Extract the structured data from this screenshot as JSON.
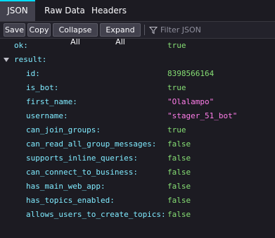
{
  "tabs": [
    {
      "label": "JSON",
      "active": true
    },
    {
      "label": "Raw Data",
      "active": false
    },
    {
      "label": "Headers",
      "active": false
    }
  ],
  "toolbar": {
    "save_label": "Save",
    "copy_label": "Copy",
    "collapse_label": "Collapse All",
    "expand_label": "Expand All",
    "filter_placeholder": "Filter JSON",
    "filter_value": ""
  },
  "json": {
    "ok": {
      "key": "ok:",
      "value": "true"
    },
    "result": {
      "key": "result:",
      "expanded": true,
      "fields": [
        {
          "key": "id:",
          "value": "8398566164",
          "type": "num"
        },
        {
          "key": "is_bot:",
          "value": "true",
          "type": "bool"
        },
        {
          "key": "first_name:",
          "value": "\"Olalampo\"",
          "type": "str"
        },
        {
          "key": "username:",
          "value": "\"stager_51_bot\"",
          "type": "str"
        },
        {
          "key": "can_join_groups:",
          "value": "true",
          "type": "bool"
        },
        {
          "key": "can_read_all_group_messages:",
          "value": "false",
          "type": "bool"
        },
        {
          "key": "supports_inline_queries:",
          "value": "false",
          "type": "bool"
        },
        {
          "key": "can_connect_to_business:",
          "value": "false",
          "type": "bool"
        },
        {
          "key": "has_main_web_app:",
          "value": "false",
          "type": "bool"
        },
        {
          "key": "has_topics_enabled:",
          "value": "false",
          "type": "bool"
        },
        {
          "key": "allows_users_to_create_topics:",
          "value": "false",
          "type": "bool"
        }
      ]
    }
  },
  "colors": {
    "background": "#1c1b22",
    "active_tab_accent": "#00ddff",
    "key": "#80ebff",
    "boolean_number": "#86de74",
    "string": "#ff7de9"
  },
  "icons": {
    "filter": "filter-icon",
    "expand_toggle": "chevron-down-icon"
  }
}
